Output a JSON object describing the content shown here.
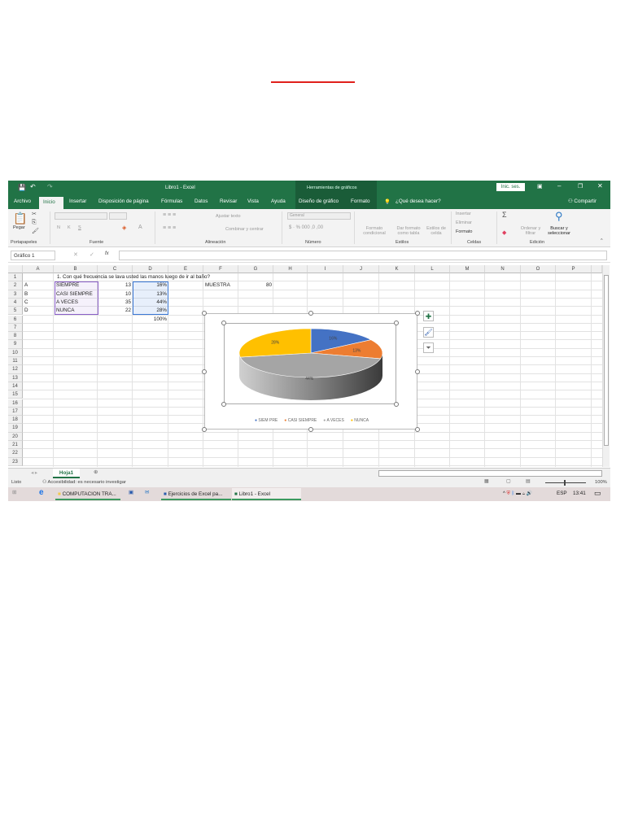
{
  "window": {
    "title": "Libro1 - Excel",
    "chart_tools": "Herramientas de gráficos",
    "signin": "Inic. ses."
  },
  "tabs": [
    "Archivo",
    "Inicio",
    "Insertar",
    "Disposición de página",
    "Fórmulas",
    "Datos",
    "Revisar",
    "Vista",
    "Ayuda",
    "Diseño de gráfico",
    "Formato"
  ],
  "tell_me": "¿Qué desea hacer?",
  "share": "Compartir",
  "ribbon": {
    "groups": [
      "Portapapeles",
      "Fuente",
      "Alineación",
      "Número",
      "Estilos",
      "Celdas",
      "Edición"
    ],
    "paste": "Pegar",
    "bold": "N",
    "italic": "K",
    "underline": "S",
    "wrap": "Ajustar texto",
    "merge": "Combinar y centrar",
    "number_format": "General",
    "cond_format": "Formato condicional",
    "table_format": "Dar formato como tabla",
    "cell_styles": "Estilos de celda",
    "insert": "Insertar",
    "delete": "Eliminar",
    "format": "Formato",
    "sort": "Ordenar y filtrar",
    "find": "Buscar y seleccionar"
  },
  "namebox": "Gráfico 1",
  "columns": [
    "A",
    "B",
    "C",
    "D",
    "E",
    "F",
    "G",
    "H",
    "I",
    "J",
    "K",
    "L",
    "M",
    "N",
    "O",
    "P"
  ],
  "rows": [
    "1",
    "2",
    "3",
    "4",
    "5",
    "6",
    "7",
    "8",
    "9",
    "10",
    "11",
    "12",
    "13",
    "14",
    "15",
    "16",
    "17",
    "18",
    "19",
    "20",
    "21",
    "22",
    "23"
  ],
  "cells": {
    "question": "1. Con qué frecuencia se lava usted las manos luego de ir al baño?",
    "letters": [
      "A",
      "B",
      "C",
      "D"
    ],
    "options": [
      "SIEMPRE",
      "CASI SIEMPRE",
      "A VECES",
      "NUNCA"
    ],
    "counts": [
      "13",
      "10",
      "35",
      "22"
    ],
    "percents": [
      "16%",
      "13%",
      "44%",
      "28%"
    ],
    "total": "100%",
    "sample_label": "MUESTRA",
    "sample_value": "80"
  },
  "chart_data": {
    "type": "pie",
    "style": "3d",
    "categories": [
      "SIEM PRE",
      "CASI SIEMPRE",
      "A VECES",
      "NUNCA"
    ],
    "values": [
      16,
      13,
      44,
      28
    ],
    "labels": [
      "16%",
      "13%",
      "44%",
      "28%"
    ],
    "colors": [
      "#4472c4",
      "#ed7d31",
      "#a5a5a5",
      "#ffc000"
    ],
    "legend": "bottom"
  },
  "sheet_tab": "Hoja1",
  "status": {
    "ready": "Listo",
    "accessibility": "Accesibilidad: es necesario investigar",
    "zoom": "100%"
  },
  "taskbar": {
    "items": [
      "COMPUTACION TRA...",
      "Ejercicios de Excel pa...",
      "Libro1 - Excel"
    ],
    "lang": "ESP",
    "time": "13:41"
  }
}
